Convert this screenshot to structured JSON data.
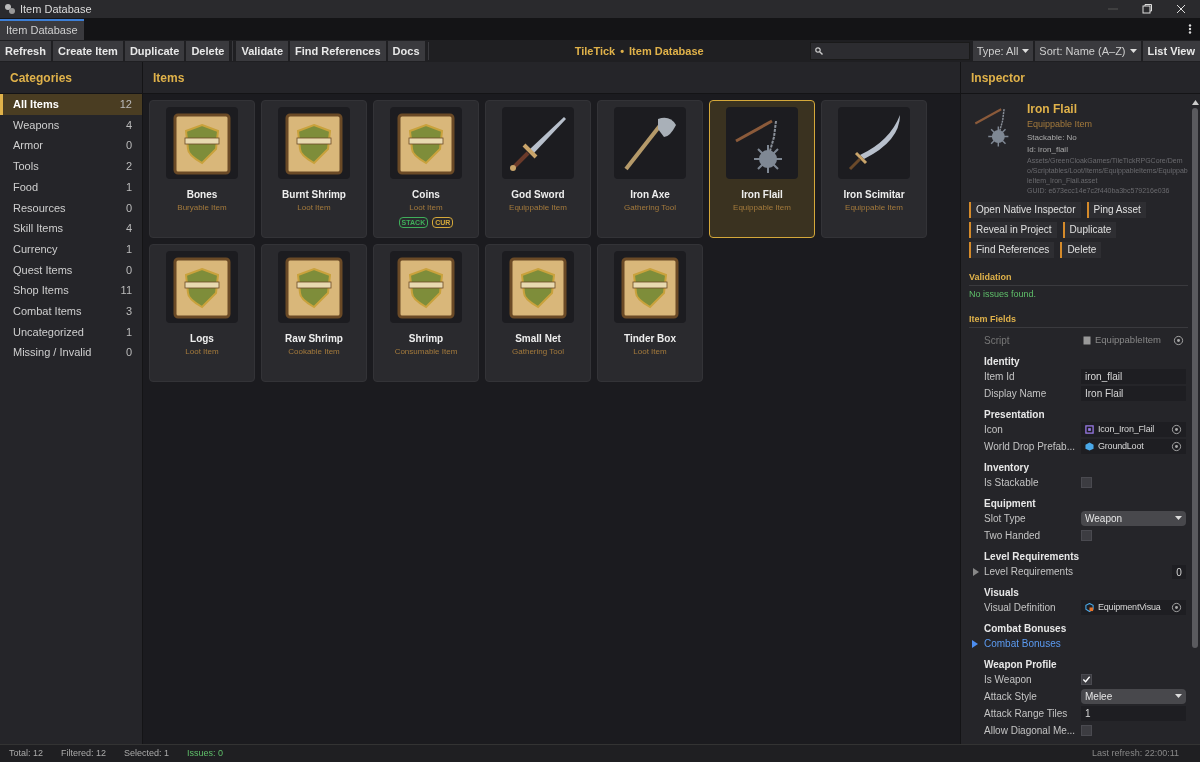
{
  "window": {
    "title": "Item Database"
  },
  "tabs": [
    {
      "label": "Item Database",
      "selected": true
    }
  ],
  "toolbar": {
    "groups": [
      [
        "Refresh",
        "Create Item",
        "Duplicate",
        "Delete"
      ],
      [
        "Validate",
        "Find References",
        "Docs"
      ]
    ],
    "brand": "TileTick",
    "separator": "•",
    "page": "Item Database",
    "type_filter": "Type: All",
    "sort": "Sort: Name (A–Z)",
    "view_button": "List View"
  },
  "categories": {
    "title": "Categories",
    "items": [
      {
        "label": "All Items",
        "count": "12",
        "selected": true
      },
      {
        "label": "Weapons",
        "count": "4",
        "selected": false
      },
      {
        "label": "Armor",
        "count": "0",
        "selected": false
      },
      {
        "label": "Tools",
        "count": "2",
        "selected": false
      },
      {
        "label": "Food",
        "count": "1",
        "selected": false
      },
      {
        "label": "Resources",
        "count": "0",
        "selected": false
      },
      {
        "label": "Skill Items",
        "count": "4",
        "selected": false
      },
      {
        "label": "Currency",
        "count": "1",
        "selected": false
      },
      {
        "label": "Quest Items",
        "count": "0",
        "selected": false
      },
      {
        "label": "Shop Items",
        "count": "11",
        "selected": false
      },
      {
        "label": "Combat Items",
        "count": "3",
        "selected": false
      },
      {
        "label": "Uncategorized",
        "count": "1",
        "selected": false
      },
      {
        "label": "Missing / Invalid",
        "count": "0",
        "selected": false
      }
    ]
  },
  "items": {
    "title": "Items",
    "cards": [
      {
        "name": "Bones",
        "type": "Buryable Item",
        "kind": "placeholder",
        "selected": false
      },
      {
        "name": "Burnt Shrimp",
        "type": "Loot Item",
        "kind": "placeholder",
        "selected": false
      },
      {
        "name": "Coins",
        "type": "Loot Item",
        "kind": "placeholder",
        "selected": false,
        "badges": [
          {
            "label": "STACK",
            "color": "#3fae5a"
          },
          {
            "label": "CUR",
            "color": "#d4a83a"
          }
        ]
      },
      {
        "name": "God Sword",
        "type": "Equippable Item",
        "kind": "sword",
        "selected": false
      },
      {
        "name": "Iron Axe",
        "type": "Gathering Tool",
        "kind": "axe",
        "selected": false
      },
      {
        "name": "Iron Flail",
        "type": "Equippable Item",
        "kind": "flail",
        "selected": true
      },
      {
        "name": "Iron Scimitar",
        "type": "Equippable Item",
        "kind": "scimitar",
        "selected": false
      },
      {
        "name": "Logs",
        "type": "Loot Item",
        "kind": "placeholder",
        "selected": false
      },
      {
        "name": "Raw Shrimp",
        "type": "Cookable Item",
        "kind": "placeholder",
        "selected": false
      },
      {
        "name": "Shrimp",
        "type": "Consumable Item",
        "kind": "placeholder",
        "selected": false
      },
      {
        "name": "Small Net",
        "type": "Gathering Tool",
        "kind": "placeholder",
        "selected": false
      },
      {
        "name": "Tinder Box",
        "type": "Loot Item",
        "kind": "placeholder",
        "selected": false
      }
    ]
  },
  "inspector": {
    "title": "Inspector",
    "name": "Iron Flail",
    "type": "Equippable Item",
    "stackable": "Stackable: No",
    "id": "Id: iron_flail",
    "path": "Assets/GreenCloakGames/TileTickRPGCore/Demo/Scriptables/Loot/Items/EquippableItems/EquippableItem_Iron_Flail.asset",
    "guid": "GUID: e673ecc14e7c2f440ba3bc579216e036",
    "actions": [
      [
        "Open Native Inspector",
        "Ping Asset"
      ],
      [
        "Reveal in Project",
        "Duplicate"
      ],
      [
        "Find References",
        "Delete"
      ]
    ],
    "validation": {
      "title": "Validation",
      "message": "No issues found."
    },
    "fields_title": "Item Fields",
    "script": {
      "label": "Script",
      "value": "EquippableItem",
      "disabled": true
    },
    "sections": [
      {
        "title": "Identity",
        "rows": [
          {
            "kind": "text",
            "label": "Item Id",
            "value": "iron_flail"
          },
          {
            "kind": "text",
            "label": "Display Name",
            "value": "Iron Flail"
          }
        ]
      },
      {
        "title": "Presentation",
        "rows": [
          {
            "kind": "sprite",
            "label": "Icon",
            "value": "Icon_Iron_Flail"
          },
          {
            "kind": "prefab",
            "label": "World Drop Prefab...",
            "value": "GroundLoot"
          }
        ]
      },
      {
        "title": "Inventory",
        "rows": [
          {
            "kind": "toggle",
            "label": "Is Stackable",
            "checked": false
          }
        ]
      },
      {
        "title": "Equipment",
        "rows": [
          {
            "kind": "dropdown",
            "label": "Slot Type",
            "value": "Weapon"
          },
          {
            "kind": "toggle",
            "label": "Two Handed",
            "checked": false
          }
        ]
      },
      {
        "title": "Level Requirements",
        "rows": [
          {
            "kind": "list",
            "label": "Level Requirements",
            "value": "0",
            "expanded": false
          }
        ]
      },
      {
        "title": "Visuals",
        "rows": [
          {
            "kind": "asset",
            "label": "Visual Definition",
            "value": "EquipmentVisua"
          }
        ]
      },
      {
        "title": "Combat Bonuses",
        "rows": [
          {
            "kind": "foldout",
            "label": "Combat Bonuses",
            "expanded": false
          }
        ]
      },
      {
        "title": "Weapon Profile",
        "rows": [
          {
            "kind": "toggle",
            "label": "Is Weapon",
            "checked": true
          },
          {
            "kind": "dropdown",
            "label": "Attack Style",
            "value": "Melee"
          },
          {
            "kind": "text",
            "label": "Attack Range Tiles",
            "value": "1"
          },
          {
            "kind": "toggle",
            "label": "Allow Diagonal Me...",
            "checked": false
          }
        ]
      }
    ]
  },
  "status_bar": {
    "total": "Total: 12",
    "filtered": "Filtered: 12",
    "selected": "Selected: 1",
    "issues": "Issues: 0",
    "last_refresh": "Last refresh: 22:00:11"
  }
}
